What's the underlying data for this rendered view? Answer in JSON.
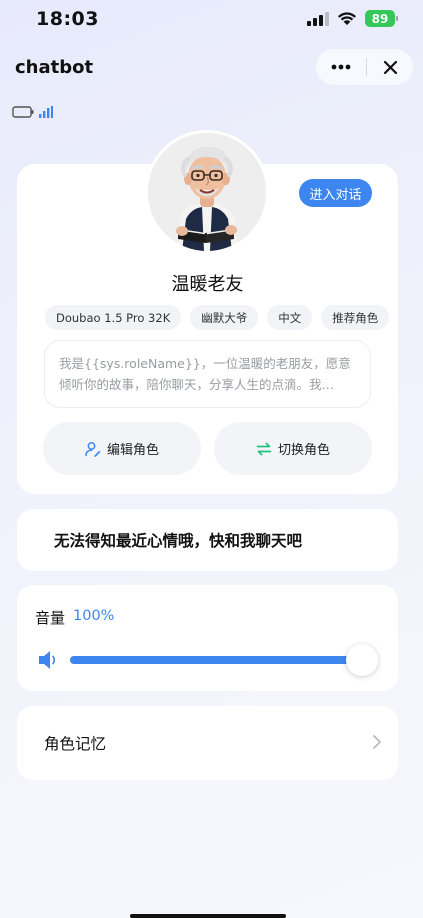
{
  "status_bar": {
    "time": "18:03",
    "battery": "89"
  },
  "header": {
    "title": "chatbot"
  },
  "role_card": {
    "enter_chat_label": "进入对话",
    "name": "温暖老友",
    "tags": [
      "Doubao 1.5 Pro 32K",
      "幽默大爷",
      "中文",
      "推荐角色"
    ],
    "prompt_line_1": "我是{{sys.roleName}}，一位温暖的老朋友，愿意",
    "prompt_line_2": "倾听你的故事，陪你聊天，分享人生的点滴。我…",
    "edit_label": "编辑角色",
    "switch_label": "切换角色"
  },
  "mood": {
    "text": "无法得知最近心情哦，快和我聊天吧"
  },
  "volume": {
    "label": "音量",
    "value_text": "100%",
    "level": 1.0
  },
  "memory": {
    "label": "角色记忆"
  },
  "colors": {
    "accent": "#3d86f0",
    "battery": "#34c759",
    "switch_icon": "#22c47a"
  }
}
